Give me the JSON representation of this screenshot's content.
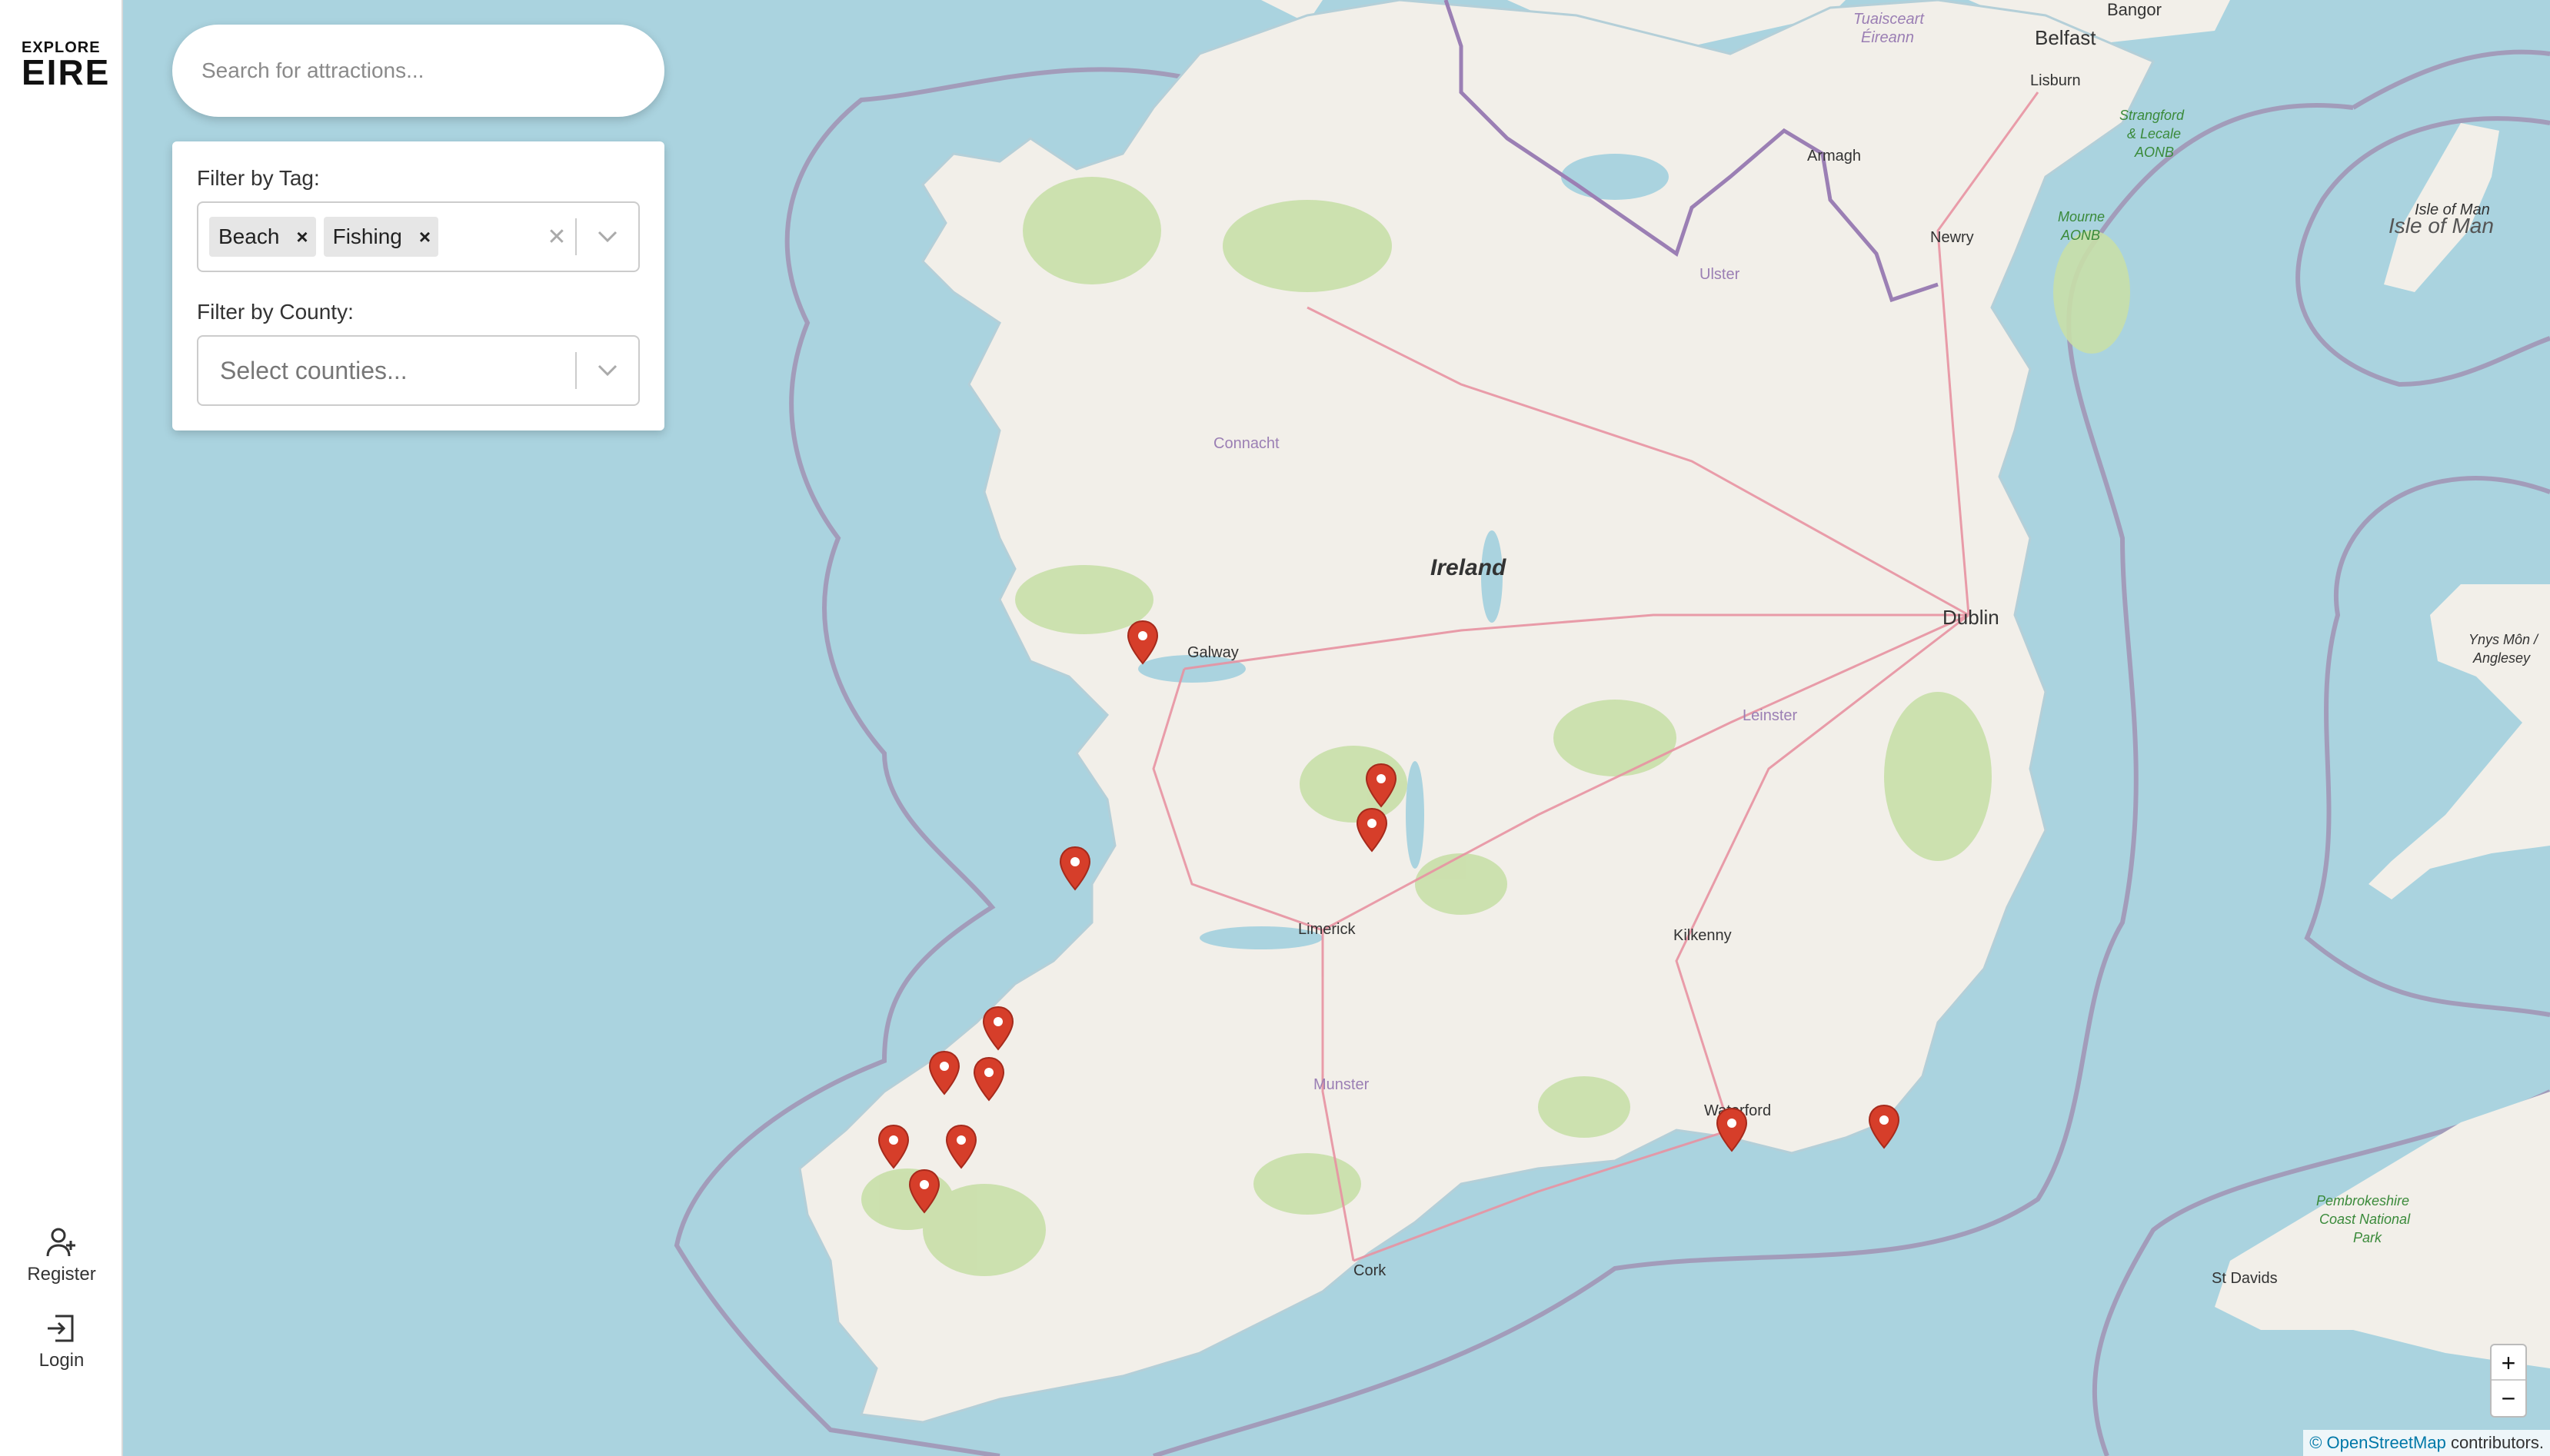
{
  "brand": {
    "line1": "EXPLORE",
    "line2": "EIRE"
  },
  "nav": {
    "register": "Register",
    "login": "Login"
  },
  "search": {
    "placeholder": "Search for attractions..."
  },
  "filters": {
    "tag_label": "Filter by Tag:",
    "tags": [
      "Beach",
      "Fishing"
    ],
    "county_label": "Filter by County:",
    "county_placeholder": "Select counties..."
  },
  "map": {
    "zoom_in": "+",
    "zoom_out": "−",
    "attribution_link": "© OpenStreetMap",
    "attribution_suffix": " contributors.",
    "place_labels": {
      "belfast": "Belfast",
      "bangor": "Bangor",
      "lisburn": "Lisburn",
      "armagh": "Armagh",
      "newry": "Newry",
      "ulster": "Ulster",
      "connacht": "Connacht",
      "ireland": "Ireland",
      "dublin": "Dublin",
      "galway": "Galway",
      "leinster": "Leinster",
      "limerick": "Limerick",
      "kilkenny": "Kilkenny",
      "munster": "Munster",
      "waterford": "Waterford",
      "cork": "Cork",
      "isle_of_man_small": "Isle of Man",
      "isle_of_man": "Isle of Man",
      "anglesey_1": "Ynys Môn /",
      "anglesey_2": "Anglesey",
      "st_davids": "St Davids",
      "strangford_1": "Strangford",
      "strangford_2": "& Lecale",
      "strangford_3": "AONB",
      "mourne_1": "Mourne",
      "mourne_2": "AONB",
      "pembrokeshire_1": "Pembrokeshire",
      "pembrokeshire_2": "Coast National",
      "pembrokeshire_3": "Park",
      "tuaisceart_1": "Tuaisceart",
      "tuaisceart_2": "Éireann"
    }
  },
  "colors": {
    "pin": "#d63e2a",
    "sea": "#aad3df",
    "land": "#f2efe9"
  }
}
